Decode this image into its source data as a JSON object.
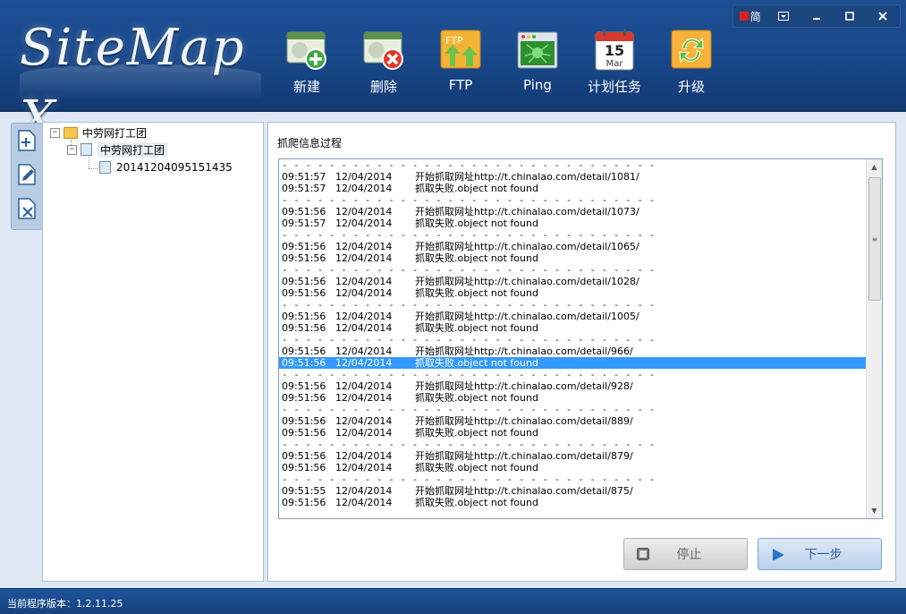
{
  "app": {
    "logo_text": "SiteMap X",
    "language_label": "简"
  },
  "toolbar": [
    {
      "label": "新建",
      "icon": "new-site-icon"
    },
    {
      "label": "删除",
      "icon": "delete-site-icon"
    },
    {
      "label": "FTP",
      "icon": "ftp-icon"
    },
    {
      "label": "Ping",
      "icon": "ping-icon"
    },
    {
      "label": "计划任务",
      "icon": "calendar-icon",
      "calendar_day": "15",
      "calendar_month": "Mar"
    },
    {
      "label": "升级",
      "icon": "upgrade-icon"
    }
  ],
  "tree": {
    "root": "中劳网打工团",
    "child": "中劳网打工团",
    "leaf": "20141204095151435"
  },
  "main": {
    "section_title": "抓爬信息过程",
    "separator": "- - - - - - - - - - - - - - - - - - - - - - - - - - - - - - - - - - - - - - - - - - - -",
    "log": [
      {
        "t1": "09:51:57",
        "d1": "12/04/2014",
        "m1": "开始抓取网址http://t.chinalao.com/detail/1081/",
        "t2": "09:51:57",
        "d2": "12/04/2014",
        "m2": "抓取失败.object not found"
      },
      {
        "t1": "09:51:56",
        "d1": "12/04/2014",
        "m1": "开始抓取网址http://t.chinalao.com/detail/1073/",
        "t2": "09:51:57",
        "d2": "12/04/2014",
        "m2": "抓取失败.object not found"
      },
      {
        "t1": "09:51:56",
        "d1": "12/04/2014",
        "m1": "开始抓取网址http://t.chinalao.com/detail/1065/",
        "t2": "09:51:56",
        "d2": "12/04/2014",
        "m2": "抓取失败.object not found"
      },
      {
        "t1": "09:51:56",
        "d1": "12/04/2014",
        "m1": "开始抓取网址http://t.chinalao.com/detail/1028/",
        "t2": "09:51:56",
        "d2": "12/04/2014",
        "m2": "抓取失败.object not found"
      },
      {
        "t1": "09:51:56",
        "d1": "12/04/2014",
        "m1": "开始抓取网址http://t.chinalao.com/detail/1005/",
        "t2": "09:51:56",
        "d2": "12/04/2014",
        "m2": "抓取失败.object not found"
      },
      {
        "t1": "09:51:56",
        "d1": "12/04/2014",
        "m1": "开始抓取网址http://t.chinalao.com/detail/966/",
        "t2": "09:51:56",
        "d2": "12/04/2014",
        "m2": "抓取失败.object not found",
        "highlight": true
      },
      {
        "t1": "09:51:56",
        "d1": "12/04/2014",
        "m1": "开始抓取网址http://t.chinalao.com/detail/928/",
        "t2": "09:51:56",
        "d2": "12/04/2014",
        "m2": "抓取失败.object not found"
      },
      {
        "t1": "09:51:56",
        "d1": "12/04/2014",
        "m1": "开始抓取网址http://t.chinalao.com/detail/889/",
        "t2": "09:51:56",
        "d2": "12/04/2014",
        "m2": "抓取失败.object not found"
      },
      {
        "t1": "09:51:56",
        "d1": "12/04/2014",
        "m1": "开始抓取网址http://t.chinalao.com/detail/879/",
        "t2": "09:51:56",
        "d2": "12/04/2014",
        "m2": "抓取失败.object not found"
      },
      {
        "t1": "09:51:55",
        "d1": "12/04/2014",
        "m1": "开始抓取网址http://t.chinalao.com/detail/875/",
        "t2": "09:51:56",
        "d2": "12/04/2014",
        "m2": "抓取失败.object not found"
      }
    ],
    "stop_label": "停止",
    "next_label": "下一步"
  },
  "status": {
    "text": "当前程序版本：1.2.11.25"
  },
  "colors": {
    "header": "#1a4a8d",
    "highlight": "#3399ff",
    "statusbar": "#1f5399"
  }
}
